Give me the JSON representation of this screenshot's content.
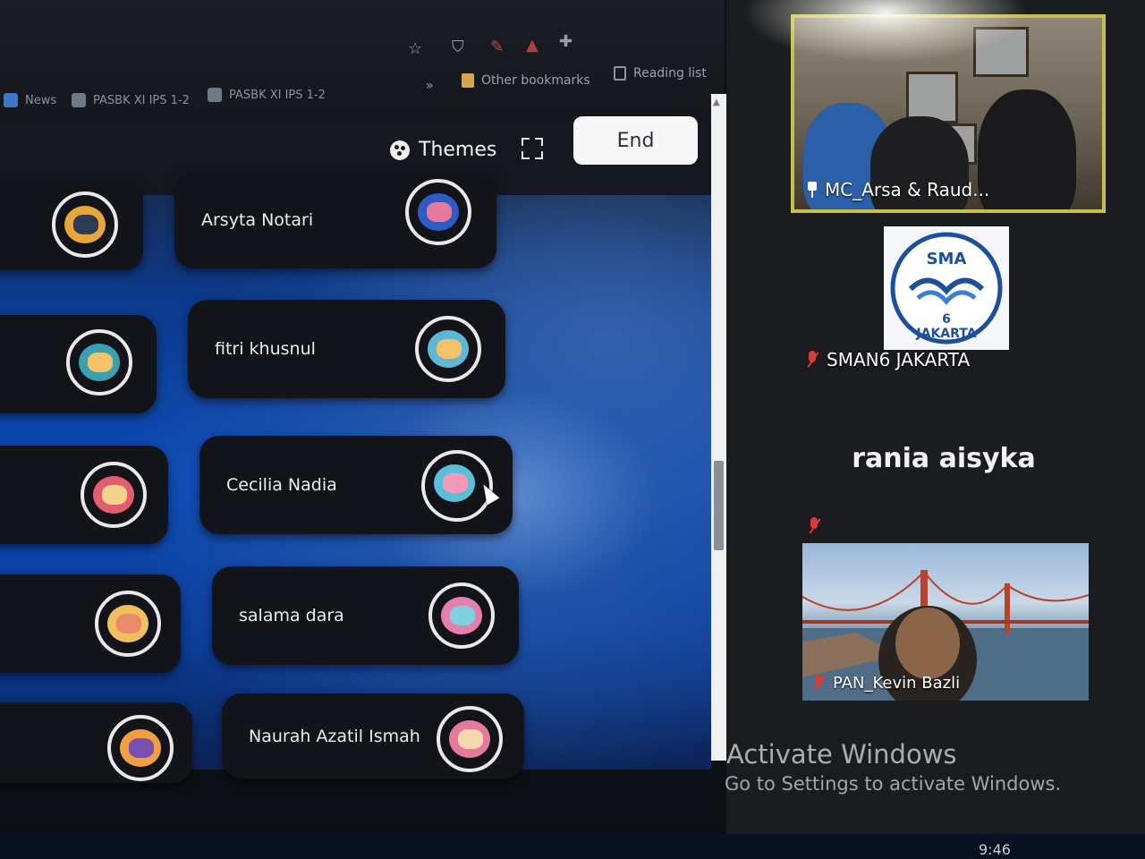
{
  "browser": {
    "bookmarks": [
      {
        "label": "News"
      },
      {
        "label": "PASBK XI IPS 1-2"
      },
      {
        "label": "PASBK XI IPS 1-2"
      }
    ],
    "overflow": "»",
    "other_bookmarks": "Other bookmarks",
    "reading_list": "Reading list",
    "toolbar_icons": [
      "star-icon",
      "shield-icon",
      "extension-icon",
      "puzzle-icon"
    ]
  },
  "quiz": {
    "themes_label": "Themes",
    "end_label": "End",
    "icons": {
      "themes": "palette-icon",
      "fullscreen": "fullscreen-icon"
    },
    "players": [
      {
        "name": "Arsyta Notari",
        "avatar": "raccoon",
        "color": "#2d5cc4"
      },
      {
        "name": "fitri khusnul",
        "avatar": "rainbow",
        "color": "#5fb7d6"
      },
      {
        "name": "Cecilia Nadia",
        "avatar": "unicorn-cat",
        "color": "#5bbfd9"
      },
      {
        "name": "salama dara",
        "avatar": "unicorn-cat",
        "color": "#e57fae"
      },
      {
        "name": "Naurah Azatil Ismah",
        "avatar": "sloth",
        "color": "#e67a9c"
      }
    ],
    "left_avatars": [
      {
        "avatar": "bus",
        "color": "#e8a63a"
      },
      {
        "avatar": "bottle",
        "color": "#3aa0b0"
      },
      {
        "avatar": "robot",
        "color": "#e35d70"
      },
      {
        "avatar": "toast",
        "color": "#f0c060"
      },
      {
        "avatar": "face",
        "color": "#f0a040"
      }
    ]
  },
  "participants": {
    "video1_label": "MC_Arsa & Raud...",
    "video2_label": "SMAN6 JAKARTA",
    "video2_logo_text_top": "SMA",
    "video2_logo_number": "6",
    "video2_logo_text_bottom": "JAKARTA",
    "video3_name": "rania aisyka",
    "video4_label": "PAN_Kevin Bazli"
  },
  "windows": {
    "activate_title": "Activate Windows",
    "activate_subtitle": "Go to Settings to activate Windows.",
    "clock": "9:46"
  },
  "colors": {
    "accent_pinned": "#c9c04a",
    "mute": "#d93a3a",
    "tile_bg": "#121419"
  }
}
